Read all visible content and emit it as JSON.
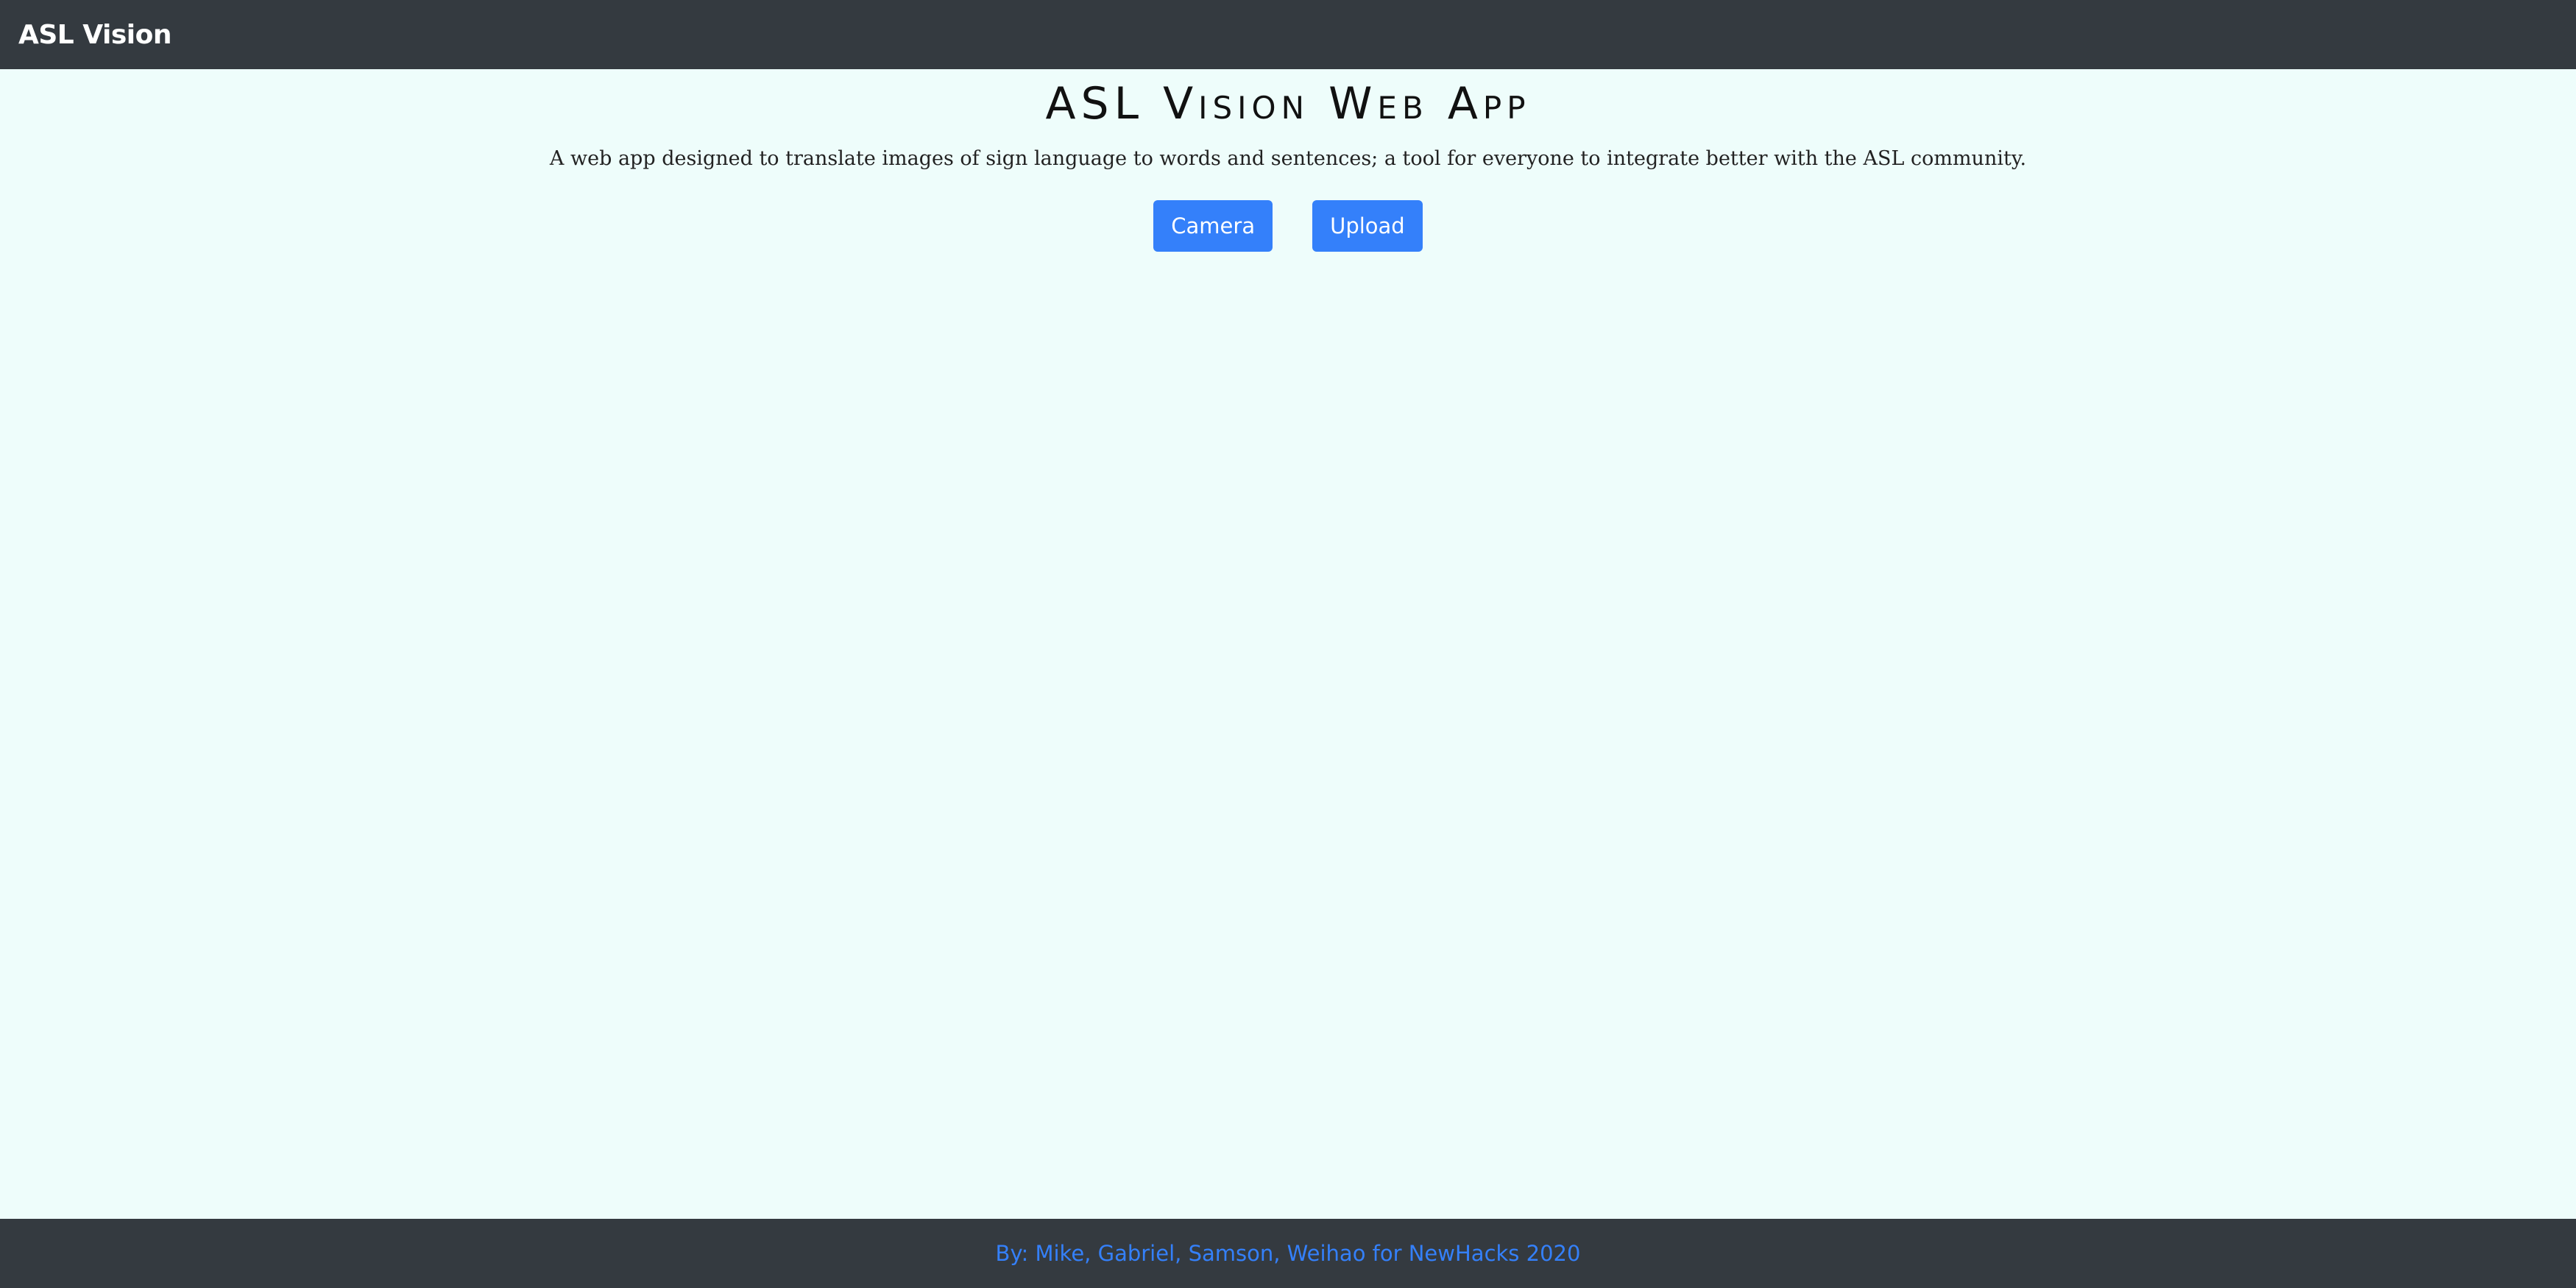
{
  "navbar": {
    "brand": "ASL Vision"
  },
  "main": {
    "title": "ASL Vision Web App",
    "description": "A web app designed to translate images of sign language to words and sentences; a tool for everyone to integrate better with the ASL community.",
    "buttons": {
      "camera_label": "Camera",
      "upload_label": "Upload"
    }
  },
  "footer": {
    "credits": "By: Mike, Gabriel, Samson, Weihao for NewHacks 2020"
  },
  "colors": {
    "navbar_bg": "#343a40",
    "page_bg": "#eefdfb",
    "accent": "#3480fa"
  }
}
